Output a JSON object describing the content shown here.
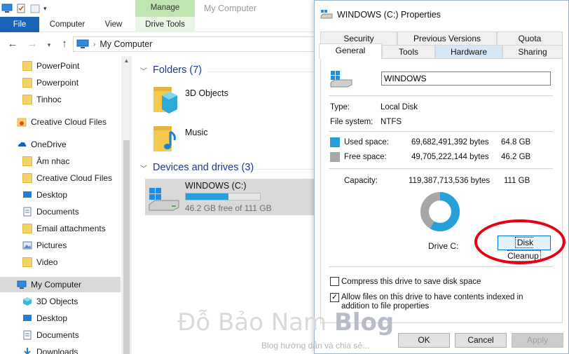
{
  "explorer": {
    "ribbon": {
      "manage_label": "Manage",
      "window_title": "My Computer",
      "tabs": [
        "File",
        "Computer",
        "View",
        "Drive Tools"
      ]
    },
    "address": {
      "path": "My Computer"
    },
    "nav_items": [
      {
        "label": "PowerPoint",
        "icon": "folder-icon"
      },
      {
        "label": "Powerpoint",
        "icon": "folder-icon"
      },
      {
        "label": "Tinhoc",
        "icon": "folder-icon"
      },
      {
        "label": "Creative Cloud Files",
        "icon": "creative-cloud-icon"
      },
      {
        "label": "OneDrive",
        "icon": "onedrive-icon"
      },
      {
        "label": "Âm nhạc",
        "icon": "folder-icon"
      },
      {
        "label": "Creative Cloud Files",
        "icon": "folder-icon"
      },
      {
        "label": "Desktop",
        "icon": "desktop-icon"
      },
      {
        "label": "Documents",
        "icon": "documents-icon"
      },
      {
        "label": "Email attachments",
        "icon": "folder-icon"
      },
      {
        "label": "Pictures",
        "icon": "pictures-icon"
      },
      {
        "label": "Video",
        "icon": "folder-icon"
      },
      {
        "label": "My Computer",
        "icon": "computer-icon"
      },
      {
        "label": "3D Objects",
        "icon": "3d-objects-icon"
      },
      {
        "label": "Desktop",
        "icon": "desktop-icon"
      },
      {
        "label": "Documents",
        "icon": "documents-icon"
      },
      {
        "label": "Downloads",
        "icon": "downloads-icon"
      }
    ],
    "content": {
      "folders_heading": "Folders (7)",
      "folders": [
        "3D Objects",
        "Music"
      ],
      "drives_heading": "Devices and drives (3)",
      "drive": {
        "name": "WINDOWS (C:)",
        "free_text": "46.2 GB free of 111 GB",
        "used_fraction": 0.58
      }
    }
  },
  "dialog": {
    "title": "WINDOWS (C:) Properties",
    "tabs_top": [
      "Security",
      "Previous Versions",
      "Quota"
    ],
    "tabs_bottom": [
      "General",
      "Tools",
      "Hardware",
      "Sharing"
    ],
    "general": {
      "volume_label": "WINDOWS",
      "type_label": "Type:",
      "type_value": "Local Disk",
      "fs_label": "File system:",
      "fs_value": "NTFS",
      "used_label": "Used space:",
      "used_bytes": "69,682,491,392 bytes",
      "used_gb": "64.8 GB",
      "free_label": "Free space:",
      "free_bytes": "49,705,222,144 bytes",
      "free_gb": "46.2 GB",
      "capacity_label": "Capacity:",
      "capacity_bytes": "119,387,713,536 bytes",
      "capacity_gb": "111 GB",
      "drive_label": "Drive C:",
      "cleanup_button": "Disk Cleanup",
      "compress_label": "Compress this drive to save disk space",
      "index_label": "Allow files on this drive to have contents indexed in addition to file properties",
      "used_color": "#26a0da",
      "free_color": "#a7a7a7",
      "used_fraction": 0.584
    },
    "buttons": {
      "ok": "OK",
      "cancel": "Cancel",
      "apply": "Apply"
    }
  },
  "watermark": {
    "main": "Đỗ Bảo Nam",
    "blog": "Blog",
    "sub": "Blog hướng dẫn và chia sẻ..."
  },
  "colors": {
    "file_tab": "#1a64b8",
    "manage_tab": "#bfe6b0",
    "highlight_ring": "#e60012"
  }
}
